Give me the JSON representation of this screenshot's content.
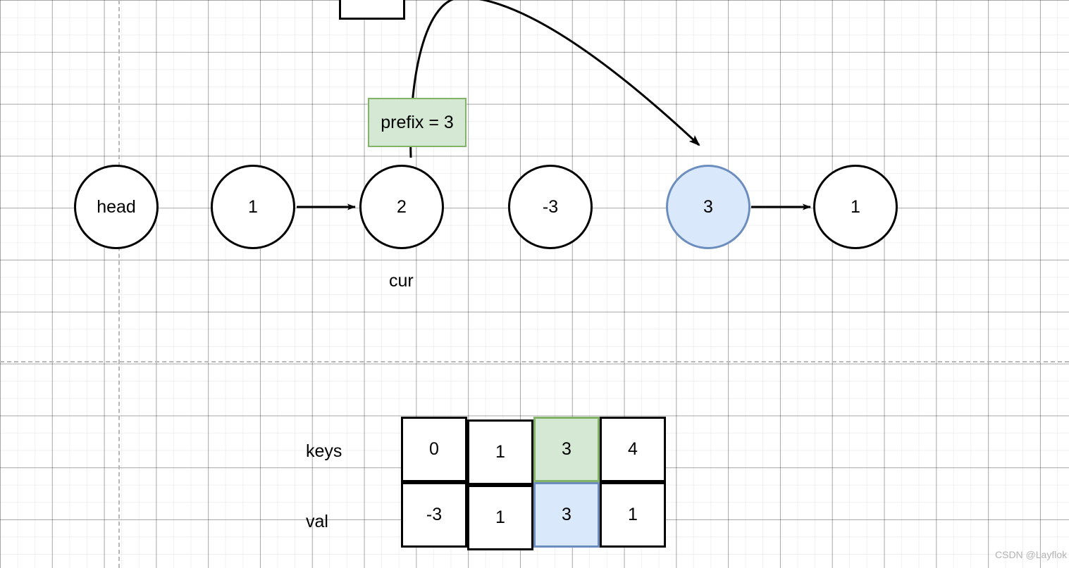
{
  "diagram": {
    "title_watermark": "CSDN @Layflok",
    "linked_list": {
      "nodes": [
        {
          "label": "head",
          "kind": "pointer",
          "highlight": "none"
        },
        {
          "label": "1",
          "kind": "value",
          "highlight": "none"
        },
        {
          "label": "2",
          "kind": "value",
          "highlight": "none"
        },
        {
          "label": "-3",
          "kind": "value",
          "highlight": "none"
        },
        {
          "label": "3",
          "kind": "value",
          "highlight": "blue"
        },
        {
          "label": "1",
          "kind": "value",
          "highlight": "none"
        }
      ],
      "pointer_labels": [
        {
          "text": "cur",
          "points_to": "2"
        }
      ]
    },
    "annotation": {
      "prefix_box_label": "prefix = 3"
    },
    "table": {
      "row_labels": [
        "keys",
        "val"
      ],
      "rows": [
        {
          "name": "keys",
          "cells": [
            "0",
            "1",
            "3",
            "4"
          ]
        },
        {
          "name": "val",
          "cells": [
            "-3",
            "1",
            "3",
            "1"
          ]
        }
      ],
      "highlighted_column_index": 2
    },
    "colors": {
      "green_fill": "#d5e8d4",
      "green_stroke": "#82b366",
      "blue_fill": "#dae8fc",
      "blue_stroke": "#6c8ebf",
      "stroke": "#000000"
    }
  }
}
